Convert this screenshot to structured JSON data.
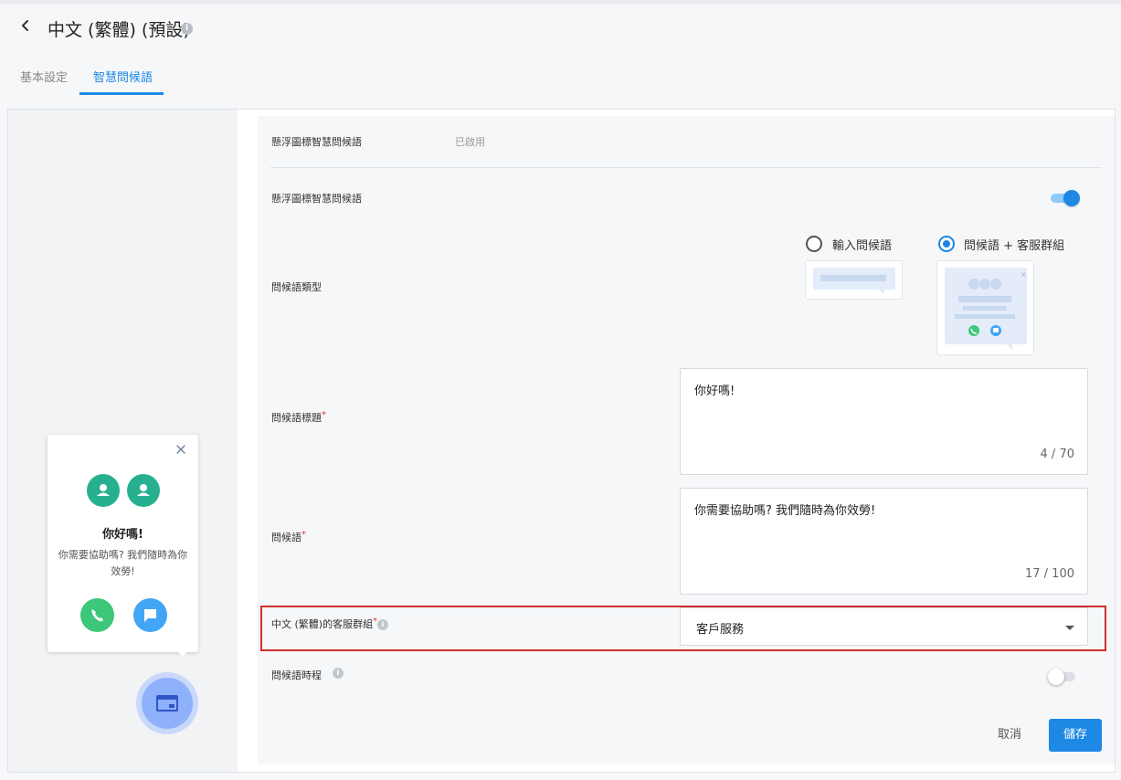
{
  "header": {
    "title": "中文 (繁體) (預設)",
    "tabs": [
      {
        "label": "基本設定",
        "active": false
      },
      {
        "label": "智慧問候語",
        "active": true
      }
    ]
  },
  "summary": {
    "label": "懸浮圖標智慧問候語",
    "status": "已啟用"
  },
  "enable_toggle": {
    "label": "懸浮圖標智慧問候語",
    "on": true
  },
  "greeting_type": {
    "label": "問候語類型",
    "options": [
      {
        "label": "輸入問候語",
        "selected": false
      },
      {
        "label": "問候語 + 客服群組",
        "selected": true
      }
    ]
  },
  "greeting_title": {
    "label": "問候語標題",
    "required_mark": "*",
    "value": "你好嗎!",
    "counter": "4 / 70"
  },
  "greeting_message": {
    "label": "問候語",
    "required_mark": "*",
    "value": "你需要協助嗎? 我們隨時為你效勞!",
    "counter": "17 / 100"
  },
  "service_group": {
    "label": "中文 (繁體)的客服群組",
    "required_mark": "*",
    "selected": "客戶服務"
  },
  "schedule": {
    "label": "問候語時程",
    "on": false
  },
  "actions": {
    "cancel": "取消",
    "save": "儲存"
  },
  "preview": {
    "title": "你好嗎!",
    "body": "你需要協助嗎? 我們隨時為你效勞!"
  },
  "colors": {
    "accent": "#1e88e5",
    "highlight_border": "#d32f2f",
    "avatar_green": "#26b08f",
    "phone_green": "#3cc77a",
    "chat_blue": "#42a5f5",
    "launcher_blue": "#8fb0fa"
  }
}
